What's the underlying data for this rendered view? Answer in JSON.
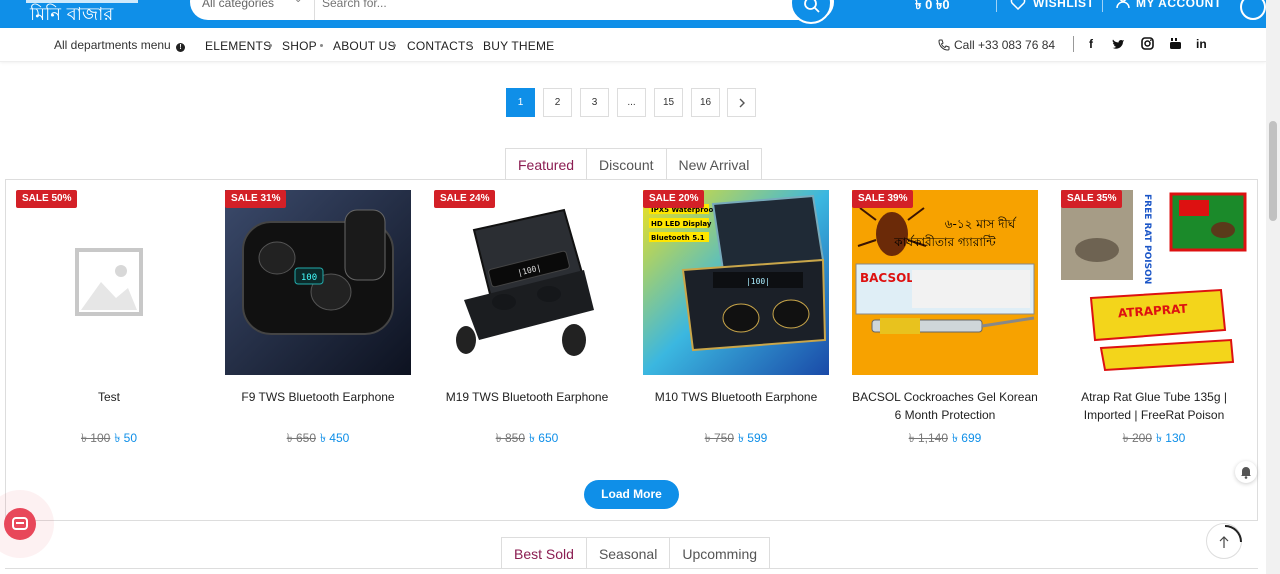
{
  "header": {
    "logo_text": "মিনি বাজার",
    "category_select": "All categories",
    "search_placeholder": "Search for...",
    "cart_amount": "৳ 0 ৳0",
    "wishlist_label": "WISHLIST",
    "account_label": "MY ACCOUNT",
    "brand_color": "#0f8fe8"
  },
  "nav": {
    "departments_label": "All departments menu",
    "items": [
      "ELEMENTS",
      "SHOP",
      "ABOUT US",
      "CONTACTS",
      "BUY THEME"
    ],
    "phone": "Call +33 083 76 84",
    "social_icons": [
      "facebook-icon",
      "twitter-icon",
      "instagram-icon",
      "youtube-icon",
      "linkedin-icon"
    ]
  },
  "pagination": {
    "pages": [
      "1",
      "2",
      "3",
      "...",
      "15",
      "16"
    ],
    "current": "1",
    "next_icon": "chevron-right-icon"
  },
  "tabs_top": {
    "items": [
      "Featured",
      "Discount",
      "New Arrival"
    ],
    "active": "Featured"
  },
  "products": [
    {
      "sale": "SALE 50%",
      "name": "Test",
      "old_price": "৳ 100",
      "new_price": "৳ 50",
      "image": "placeholder-image"
    },
    {
      "sale": "SALE 31%",
      "name": "F9 TWS Bluetooth Earphone",
      "old_price": "৳ 650",
      "new_price": "৳ 450",
      "image": "earphone-case-image"
    },
    {
      "sale": "SALE 24%",
      "name": "M19 TWS Bluetooth Earphone",
      "old_price": "৳ 850",
      "new_price": "৳ 650",
      "image": "earphone-case-image"
    },
    {
      "sale": "SALE 20%",
      "name": "M10 TWS Bluetooth Earphone",
      "old_price": "৳ 750",
      "new_price": "৳ 599",
      "image": "earphone-case-image",
      "image_text": [
        "IPX5 Waterproof",
        "HD LED Display",
        "Bluetooth 5.1"
      ]
    },
    {
      "sale": "SALE 39%",
      "name": "BACSOL Cockroaches Gel Korean 6 Month Protection",
      "old_price": "৳ 1,140",
      "new_price": "৳ 699",
      "image": "cockroach-gel-image",
      "image_text": [
        "৬-১২ মাস দীর্ঘ",
        "কার্যকারীতার গ্যারান্টি",
        "BACSOL"
      ]
    },
    {
      "sale": "SALE 35%",
      "name": "Atrap Rat Glue Tube 135g | Imported | FreeRat Poison",
      "old_price": "৳ 200",
      "new_price": "৳ 130",
      "image": "rat-glue-image",
      "image_text": [
        "FREE RAT POISON",
        "ATRAPRAT"
      ]
    }
  ],
  "load_more_label": "Load More",
  "tabs_bottom": {
    "items": [
      "Best Sold",
      "Seasonal",
      "Upcomming"
    ],
    "active": "Best Sold"
  }
}
